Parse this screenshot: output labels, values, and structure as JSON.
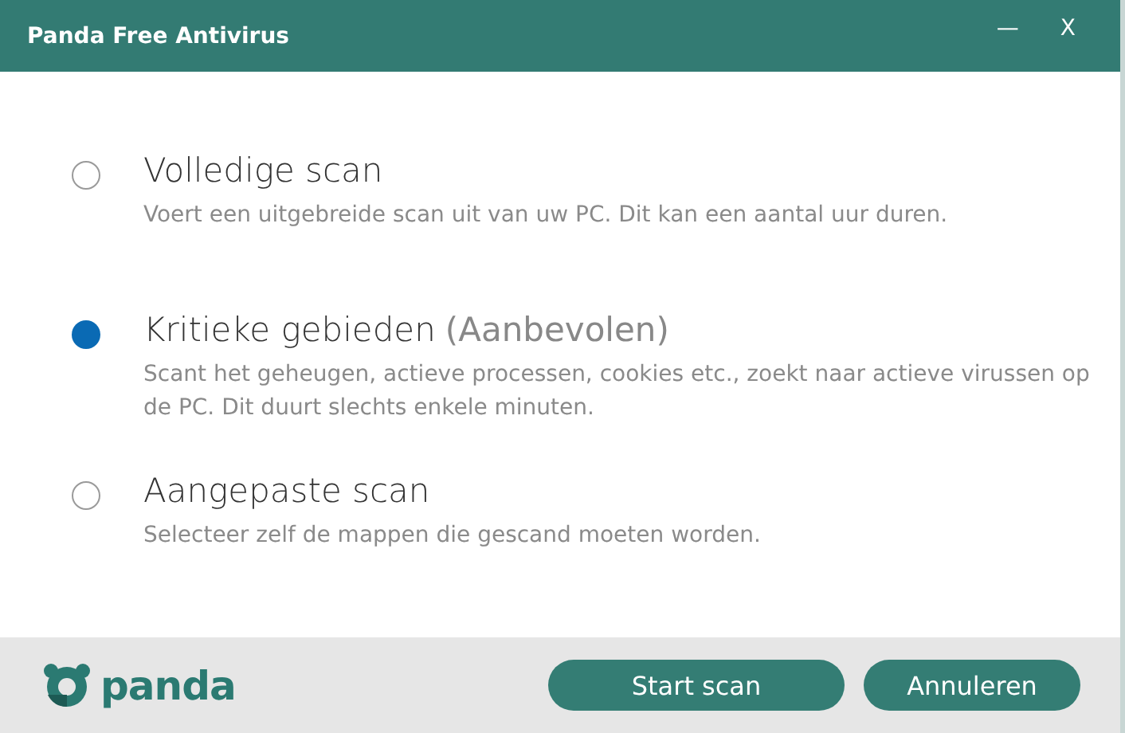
{
  "window": {
    "title": "Panda Free Antivirus",
    "controls": [
      "—",
      "X"
    ]
  },
  "options": [
    {
      "label": "Volledige scan",
      "description": "Voert een uitgebreide scan uit van uw PC. Dit kan een aantal uur duren.",
      "selected": false
    },
    {
      "label": "Kritieke gebieden",
      "note": "(Aanbevolen)",
      "description": "Scant het geheugen, actieve processen, cookies etc., zoekt naar actieve virussen op de PC. Dit duurt slechts enkele minuten.",
      "selected": true
    },
    {
      "label": "Aangepaste scan",
      "description": "Selecteer zelf de mappen die gescand moeten worden.",
      "selected": false
    }
  ],
  "footer": {
    "logo": "panda",
    "buttons": [
      "Start scan",
      "Annuleren"
    ]
  }
}
